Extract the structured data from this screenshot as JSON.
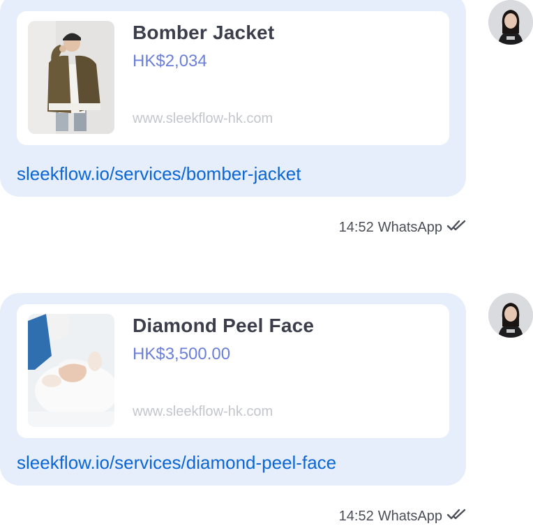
{
  "messages": [
    {
      "product_title": "Bomber Jacket",
      "price": "HK$2,034",
      "site": "www.sleekflow-hk.com",
      "link": "sleekflow.io/services/bomber-jacket",
      "time": "14:52",
      "channel": "WhatsApp",
      "status_icon": "double-check-icon",
      "image": "person-in-brown-bomber-jacket"
    },
    {
      "product_title": "Diamond Peel Face",
      "price": "HK$3,500.00",
      "site": "www.sleekflow-hk.com",
      "link": "sleekflow.io/services/diamond-peel-face",
      "time": "14:52",
      "channel": "WhatsApp",
      "status_icon": "double-check-icon",
      "image": "facial-treatment"
    }
  ],
  "colors": {
    "bubble": "#e6eefb",
    "card": "#ffffff",
    "title": "#3b3d4a",
    "price": "#6c7fd8",
    "site": "#c4c6cd",
    "link": "#0a66d6",
    "meta": "#4b4d57"
  }
}
